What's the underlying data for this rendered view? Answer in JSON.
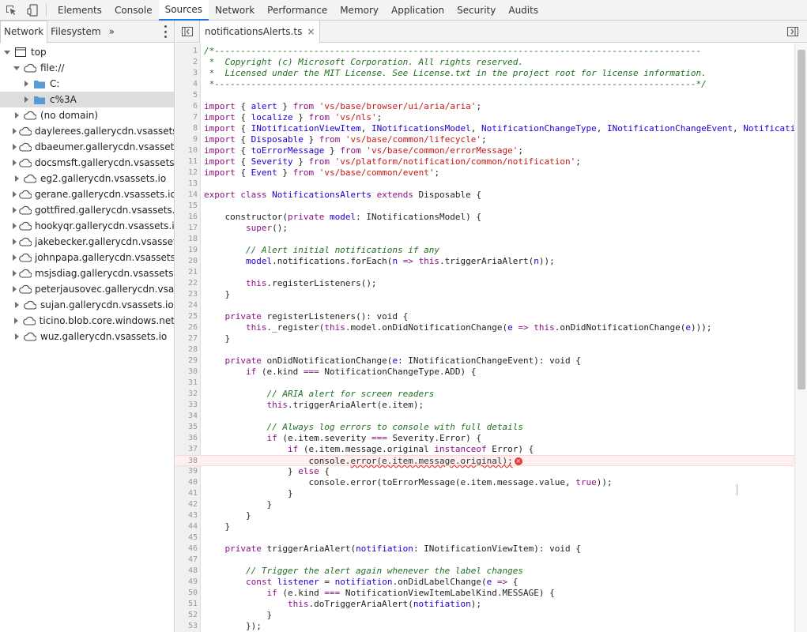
{
  "toolbar": {
    "tabs": [
      "Elements",
      "Console",
      "Sources",
      "Network",
      "Performance",
      "Memory",
      "Application",
      "Security",
      "Audits"
    ],
    "active_tab": "Sources"
  },
  "navigator": {
    "tabs": [
      "Network",
      "Filesystem"
    ],
    "more": "»",
    "tree": [
      {
        "label": "top",
        "icon": "frame-icon",
        "arrow": "down",
        "depth": 0
      },
      {
        "label": "file://",
        "icon": "cloud-icon",
        "arrow": "down",
        "depth": 1
      },
      {
        "label": "C:",
        "icon": "folder-icon",
        "arrow": "right",
        "depth": 2
      },
      {
        "label": "c%3A",
        "icon": "folder-icon",
        "arrow": "right",
        "depth": 2,
        "selected": true
      },
      {
        "label": "(no domain)",
        "icon": "cloud-icon",
        "arrow": "right",
        "depth": 1
      },
      {
        "label": "daylerees.gallerycdn.vsassets.io",
        "icon": "cloud-icon",
        "arrow": "right",
        "depth": 1
      },
      {
        "label": "dbaeumer.gallerycdn.vsassets.io",
        "icon": "cloud-icon",
        "arrow": "right",
        "depth": 1
      },
      {
        "label": "docsmsft.gallerycdn.vsassets.io",
        "icon": "cloud-icon",
        "arrow": "right",
        "depth": 1
      },
      {
        "label": "eg2.gallerycdn.vsassets.io",
        "icon": "cloud-icon",
        "arrow": "right",
        "depth": 1
      },
      {
        "label": "gerane.gallerycdn.vsassets.io",
        "icon": "cloud-icon",
        "arrow": "right",
        "depth": 1
      },
      {
        "label": "gottfired.gallerycdn.vsassets.io",
        "icon": "cloud-icon",
        "arrow": "right",
        "depth": 1
      },
      {
        "label": "hookyqr.gallerycdn.vsassets.io",
        "icon": "cloud-icon",
        "arrow": "right",
        "depth": 1
      },
      {
        "label": "jakebecker.gallerycdn.vsassets.io",
        "icon": "cloud-icon",
        "arrow": "right",
        "depth": 1
      },
      {
        "label": "johnpapa.gallerycdn.vsassets.io",
        "icon": "cloud-icon",
        "arrow": "right",
        "depth": 1
      },
      {
        "label": "msjsdiag.gallerycdn.vsassets.io",
        "icon": "cloud-icon",
        "arrow": "right",
        "depth": 1
      },
      {
        "label": "peterjausovec.gallerycdn.vsassets",
        "icon": "cloud-icon",
        "arrow": "right",
        "depth": 1
      },
      {
        "label": "sujan.gallerycdn.vsassets.io",
        "icon": "cloud-icon",
        "arrow": "right",
        "depth": 1
      },
      {
        "label": "ticino.blob.core.windows.net",
        "icon": "cloud-icon",
        "arrow": "right",
        "depth": 1
      },
      {
        "label": "wuz.gallerycdn.vsassets.io",
        "icon": "cloud-icon",
        "arrow": "right",
        "depth": 1
      }
    ]
  },
  "editor": {
    "file_tab": "notificationsAlerts.ts",
    "close": "×",
    "error_line": 38,
    "lines": [
      [
        [
          "c-com",
          "/*---------------------------------------------------------------------------------------------"
        ]
      ],
      [
        [
          "c-com",
          " *  Copyright (c) Microsoft Corporation. All rights reserved."
        ]
      ],
      [
        [
          "c-com",
          " *  Licensed under the MIT License. See License.txt in the project root for license information."
        ]
      ],
      [
        [
          "c-com",
          " *--------------------------------------------------------------------------------------------*/"
        ]
      ],
      [],
      [
        [
          "c-kw",
          "import"
        ],
        [
          "c-def",
          " { "
        ],
        [
          "c-ty",
          "alert"
        ],
        [
          "c-def",
          " } "
        ],
        [
          "c-kw",
          "from"
        ],
        [
          "c-def",
          " "
        ],
        [
          "c-str",
          "'vs/base/browser/ui/aria/aria'"
        ],
        [
          "c-def",
          ";"
        ]
      ],
      [
        [
          "c-kw",
          "import"
        ],
        [
          "c-def",
          " { "
        ],
        [
          "c-ty",
          "localize"
        ],
        [
          "c-def",
          " } "
        ],
        [
          "c-kw",
          "from"
        ],
        [
          "c-def",
          " "
        ],
        [
          "c-str",
          "'vs/nls'"
        ],
        [
          "c-def",
          ";"
        ]
      ],
      [
        [
          "c-kw",
          "import"
        ],
        [
          "c-def",
          " { "
        ],
        [
          "c-ty",
          "INotificationViewItem"
        ],
        [
          "c-def",
          ", "
        ],
        [
          "c-ty",
          "INotificationsModel"
        ],
        [
          "c-def",
          ", "
        ],
        [
          "c-ty",
          "NotificationChangeType"
        ],
        [
          "c-def",
          ", "
        ],
        [
          "c-ty",
          "INotificationChangeEvent"
        ],
        [
          "c-def",
          ", "
        ],
        [
          "c-ty",
          "Notificati"
        ]
      ],
      [
        [
          "c-kw",
          "import"
        ],
        [
          "c-def",
          " { "
        ],
        [
          "c-ty",
          "Disposable"
        ],
        [
          "c-def",
          " } "
        ],
        [
          "c-kw",
          "from"
        ],
        [
          "c-def",
          " "
        ],
        [
          "c-str",
          "'vs/base/common/lifecycle'"
        ],
        [
          "c-def",
          ";"
        ]
      ],
      [
        [
          "c-kw",
          "import"
        ],
        [
          "c-def",
          " { "
        ],
        [
          "c-ty",
          "toErrorMessage"
        ],
        [
          "c-def",
          " } "
        ],
        [
          "c-kw",
          "from"
        ],
        [
          "c-def",
          " "
        ],
        [
          "c-str",
          "'vs/base/common/errorMessage'"
        ],
        [
          "c-def",
          ";"
        ]
      ],
      [
        [
          "c-kw",
          "import"
        ],
        [
          "c-def",
          " { "
        ],
        [
          "c-ty",
          "Severity"
        ],
        [
          "c-def",
          " } "
        ],
        [
          "c-kw",
          "from"
        ],
        [
          "c-def",
          " "
        ],
        [
          "c-str",
          "'vs/platform/notification/common/notification'"
        ],
        [
          "c-def",
          ";"
        ]
      ],
      [
        [
          "c-kw",
          "import"
        ],
        [
          "c-def",
          " { "
        ],
        [
          "c-ty",
          "Event"
        ],
        [
          "c-def",
          " } "
        ],
        [
          "c-kw",
          "from"
        ],
        [
          "c-def",
          " "
        ],
        [
          "c-str",
          "'vs/base/common/event'"
        ],
        [
          "c-def",
          ";"
        ]
      ],
      [],
      [
        [
          "c-kw",
          "export class"
        ],
        [
          "c-def",
          " "
        ],
        [
          "c-ty",
          "NotificationsAlerts"
        ],
        [
          "c-def",
          " "
        ],
        [
          "c-kw",
          "extends"
        ],
        [
          "c-def",
          " Disposable {"
        ]
      ],
      [],
      [
        [
          "c-def",
          "    constructor("
        ],
        [
          "c-kw",
          "private"
        ],
        [
          "c-def",
          " "
        ],
        [
          "c-ty",
          "model"
        ],
        [
          "c-def",
          ": INotificationsModel) {"
        ]
      ],
      [
        [
          "c-def",
          "        "
        ],
        [
          "c-kw",
          "super"
        ],
        [
          "c-def",
          "();"
        ]
      ],
      [],
      [
        [
          "c-com",
          "        // Alert initial notifications if any"
        ]
      ],
      [
        [
          "c-def",
          "        "
        ],
        [
          "c-ty",
          "model"
        ],
        [
          "c-def",
          ".notifications.forEach("
        ],
        [
          "c-ty",
          "n"
        ],
        [
          "c-def",
          " "
        ],
        [
          "c-arr",
          "=>"
        ],
        [
          "c-def",
          " "
        ],
        [
          "c-kw",
          "this"
        ],
        [
          "c-def",
          ".triggerAriaAlert("
        ],
        [
          "c-ty",
          "n"
        ],
        [
          "c-def",
          "));"
        ]
      ],
      [],
      [
        [
          "c-def",
          "        "
        ],
        [
          "c-kw",
          "this"
        ],
        [
          "c-def",
          ".registerListeners();"
        ]
      ],
      [
        [
          "c-def",
          "    }"
        ]
      ],
      [],
      [
        [
          "c-def",
          "    "
        ],
        [
          "c-kw",
          "private"
        ],
        [
          "c-def",
          " registerListeners(): void {"
        ]
      ],
      [
        [
          "c-def",
          "        "
        ],
        [
          "c-kw",
          "this"
        ],
        [
          "c-def",
          "._register("
        ],
        [
          "c-kw",
          "this"
        ],
        [
          "c-def",
          ".model.onDidNotificationChange("
        ],
        [
          "c-ty",
          "e"
        ],
        [
          "c-def",
          " "
        ],
        [
          "c-arr",
          "=>"
        ],
        [
          "c-def",
          " "
        ],
        [
          "c-kw",
          "this"
        ],
        [
          "c-def",
          ".onDidNotificationChange("
        ],
        [
          "c-ty",
          "e"
        ],
        [
          "c-def",
          ")));"
        ]
      ],
      [
        [
          "c-def",
          "    }"
        ]
      ],
      [],
      [
        [
          "c-def",
          "    "
        ],
        [
          "c-kw",
          "private"
        ],
        [
          "c-def",
          " onDidNotificationChange("
        ],
        [
          "c-ty",
          "e"
        ],
        [
          "c-def",
          ": INotificationChangeEvent): void {"
        ]
      ],
      [
        [
          "c-def",
          "        "
        ],
        [
          "c-kw",
          "if"
        ],
        [
          "c-def",
          " (e.kind "
        ],
        [
          "c-kw",
          "==="
        ],
        [
          "c-def",
          " NotificationChangeType.ADD) {"
        ]
      ],
      [],
      [
        [
          "c-com",
          "            // ARIA alert for screen readers"
        ]
      ],
      [
        [
          "c-def",
          "            "
        ],
        [
          "c-kw",
          "this"
        ],
        [
          "c-def",
          ".triggerAriaAlert(e.item);"
        ]
      ],
      [],
      [
        [
          "c-com",
          "            // Always log errors to console with full details"
        ]
      ],
      [
        [
          "c-def",
          "            "
        ],
        [
          "c-kw",
          "if"
        ],
        [
          "c-def",
          " (e.item.severity "
        ],
        [
          "c-kw",
          "==="
        ],
        [
          "c-def",
          " Severity.Error) {"
        ]
      ],
      [
        [
          "c-def",
          "                "
        ],
        [
          "c-kw",
          "if"
        ],
        [
          "c-def",
          " (e.item.message.original "
        ],
        [
          "c-kw",
          "instanceof"
        ],
        [
          "c-def",
          " Error) {"
        ]
      ],
      [
        [
          "c-def",
          "                    console."
        ],
        [
          "squig",
          "error(e.item.message.original);"
        ]
      ],
      [
        [
          "c-def",
          "                } "
        ],
        [
          "c-kw",
          "else"
        ],
        [
          "c-def",
          " {"
        ]
      ],
      [
        [
          "c-def",
          "                    console.error(toErrorMessage(e.item.message.value, "
        ],
        [
          "c-kw",
          "true"
        ],
        [
          "c-def",
          "));"
        ]
      ],
      [
        [
          "c-def",
          "                }"
        ]
      ],
      [
        [
          "c-def",
          "            }"
        ]
      ],
      [
        [
          "c-def",
          "        }"
        ]
      ],
      [
        [
          "c-def",
          "    }"
        ]
      ],
      [],
      [
        [
          "c-def",
          "    "
        ],
        [
          "c-kw",
          "private"
        ],
        [
          "c-def",
          " triggerAriaAlert("
        ],
        [
          "c-ty",
          "notifiation"
        ],
        [
          "c-def",
          ": INotificationViewItem): void {"
        ]
      ],
      [],
      [
        [
          "c-com",
          "        // Trigger the alert again whenever the label changes"
        ]
      ],
      [
        [
          "c-def",
          "        "
        ],
        [
          "c-kw",
          "const"
        ],
        [
          "c-def",
          " "
        ],
        [
          "c-ty",
          "listener"
        ],
        [
          "c-def",
          " = "
        ],
        [
          "c-ty",
          "notifiation"
        ],
        [
          "c-def",
          ".onDidLabelChange("
        ],
        [
          "c-ty",
          "e"
        ],
        [
          "c-def",
          " "
        ],
        [
          "c-arr",
          "=>"
        ],
        [
          "c-def",
          " {"
        ]
      ],
      [
        [
          "c-def",
          "            "
        ],
        [
          "c-kw",
          "if"
        ],
        [
          "c-def",
          " (e.kind "
        ],
        [
          "c-kw",
          "==="
        ],
        [
          "c-def",
          " NotificationViewItemLabelKind.MESSAGE) {"
        ]
      ],
      [
        [
          "c-def",
          "                "
        ],
        [
          "c-kw",
          "this"
        ],
        [
          "c-def",
          ".doTriggerAriaAlert("
        ],
        [
          "c-ty",
          "notifiation"
        ],
        [
          "c-def",
          ");"
        ]
      ],
      [
        [
          "c-def",
          "            }"
        ]
      ],
      [
        [
          "c-def",
          "        });"
        ]
      ]
    ]
  }
}
